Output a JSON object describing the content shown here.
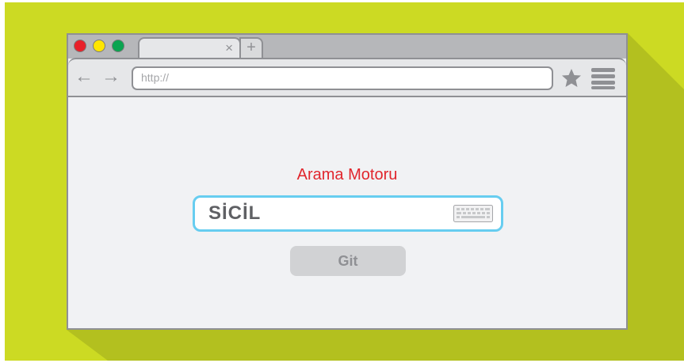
{
  "browser": {
    "tab_close_symbol": "×",
    "new_tab_symbol": "+",
    "back_symbol": "←",
    "forward_symbol": "→",
    "address_placeholder": "http://"
  },
  "page": {
    "title": "Arama Motoru",
    "search_value": "SİCİL",
    "search_button": "Git"
  },
  "icons": {
    "window_controls": [
      "red-circle",
      "yellow-circle",
      "green-circle"
    ],
    "bookmark": "star-icon",
    "menu": "hamburger-menu-icon",
    "keyboard": "keyboard-icon"
  },
  "colors": {
    "background": "#ccda23",
    "shadow": "#b3c01f",
    "window_border": "#8f9094",
    "content_background": "#f1f2f4",
    "title_red": "#e1262d",
    "search_border": "#67cdf0"
  }
}
